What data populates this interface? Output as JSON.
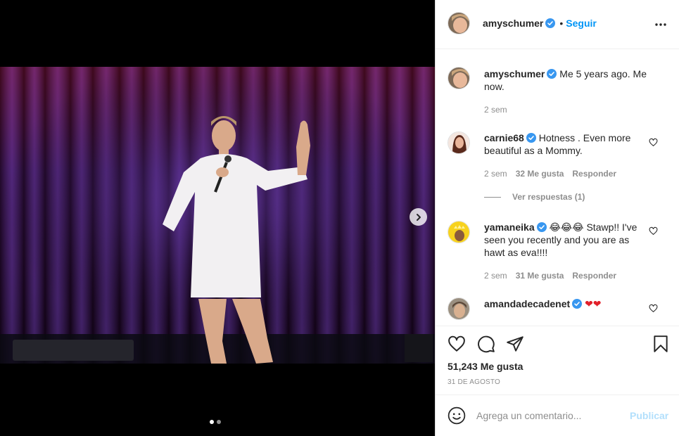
{
  "post": {
    "author": "amyschumer",
    "follow_label": "Seguir",
    "follow_separator": "•",
    "caption_author": "amyschumer",
    "caption_text": "Me 5 years ago. Me now.",
    "caption_time": "2 sem"
  },
  "comments": [
    {
      "author": "carnie68",
      "text": "Hotness . Even more beautiful as a Mommy.",
      "time": "2 sem",
      "likes": "32 Me gusta",
      "reply": "Responder",
      "view_replies": "Ver respuestas (1)"
    },
    {
      "author": "yamaneika",
      "text": "😂😂😂 Stawp!! I've seen you recently and you are as hawt as eva!!!!",
      "time": "2 sem",
      "likes": "31 Me gusta",
      "reply": "Responder"
    },
    {
      "author": "amandadecadenet",
      "text": "❤❤"
    }
  ],
  "stats": {
    "likes": "51,243 Me gusta",
    "date": "31 DE AGOSTO"
  },
  "composer": {
    "placeholder": "Agrega un comentario...",
    "publish_label": "Publicar"
  },
  "carousel": {
    "slides": 2,
    "current": 1
  },
  "icons": {
    "verified": "verified-badge-icon",
    "more": "more-options-icon",
    "like": "heart-icon",
    "comment": "comment-bubble-icon",
    "share": "paper-plane-icon",
    "save": "bookmark-icon",
    "emoji": "smiley-icon",
    "next": "chevron-right-icon"
  },
  "colors": {
    "accent": "#0095f6",
    "verified": "#3897f0",
    "muted": "#8e8e8e",
    "publish_disabled": "#b2dffc",
    "heart_red": "#e2202a"
  }
}
